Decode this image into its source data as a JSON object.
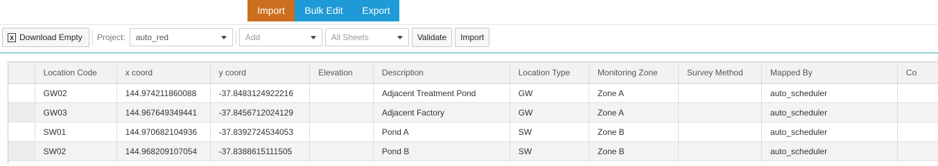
{
  "tabs": [
    {
      "label": "Import",
      "active": true
    },
    {
      "label": "Bulk Edit",
      "active": false
    },
    {
      "label": "Export",
      "active": false
    }
  ],
  "toolbar": {
    "download_label": "Download Empty",
    "project_label": "Project:",
    "project_value": "auto_red",
    "add_value": "Add",
    "sheets_value": "All Sheets",
    "validate_label": "Validate",
    "import_label": "Import"
  },
  "colors": {
    "active_tab": "#cc6f1e",
    "tab": "#1e9ad6",
    "accent_line": "#3aa6a6"
  },
  "table": {
    "columns": [
      "Location Code",
      "x coord",
      "y coord",
      "Elevation",
      "Description",
      "Location Type",
      "Monitoring Zone",
      "Survey Method",
      "Mapped By",
      "Co"
    ],
    "rows": [
      [
        "GW02",
        "144.974211860088",
        "-37.8483124922216",
        "",
        "Adjacent Treatment Pond",
        "GW",
        "Zone A",
        "",
        "auto_scheduler",
        ""
      ],
      [
        "GW03",
        "144.967649349441",
        "-37.8456712024129",
        "",
        "Adjacent Factory",
        "GW",
        "Zone A",
        "",
        "auto_scheduler",
        ""
      ],
      [
        "SW01",
        "144.970682104936",
        "-37.8392724534053",
        "",
        "Pond A",
        "SW",
        "Zone B",
        "",
        "auto_scheduler",
        ""
      ],
      [
        "SW02",
        "144.968209107054",
        "-37.8388615111505",
        "",
        "Pond B",
        "SW",
        "Zone B",
        "",
        "auto_scheduler",
        ""
      ]
    ]
  }
}
